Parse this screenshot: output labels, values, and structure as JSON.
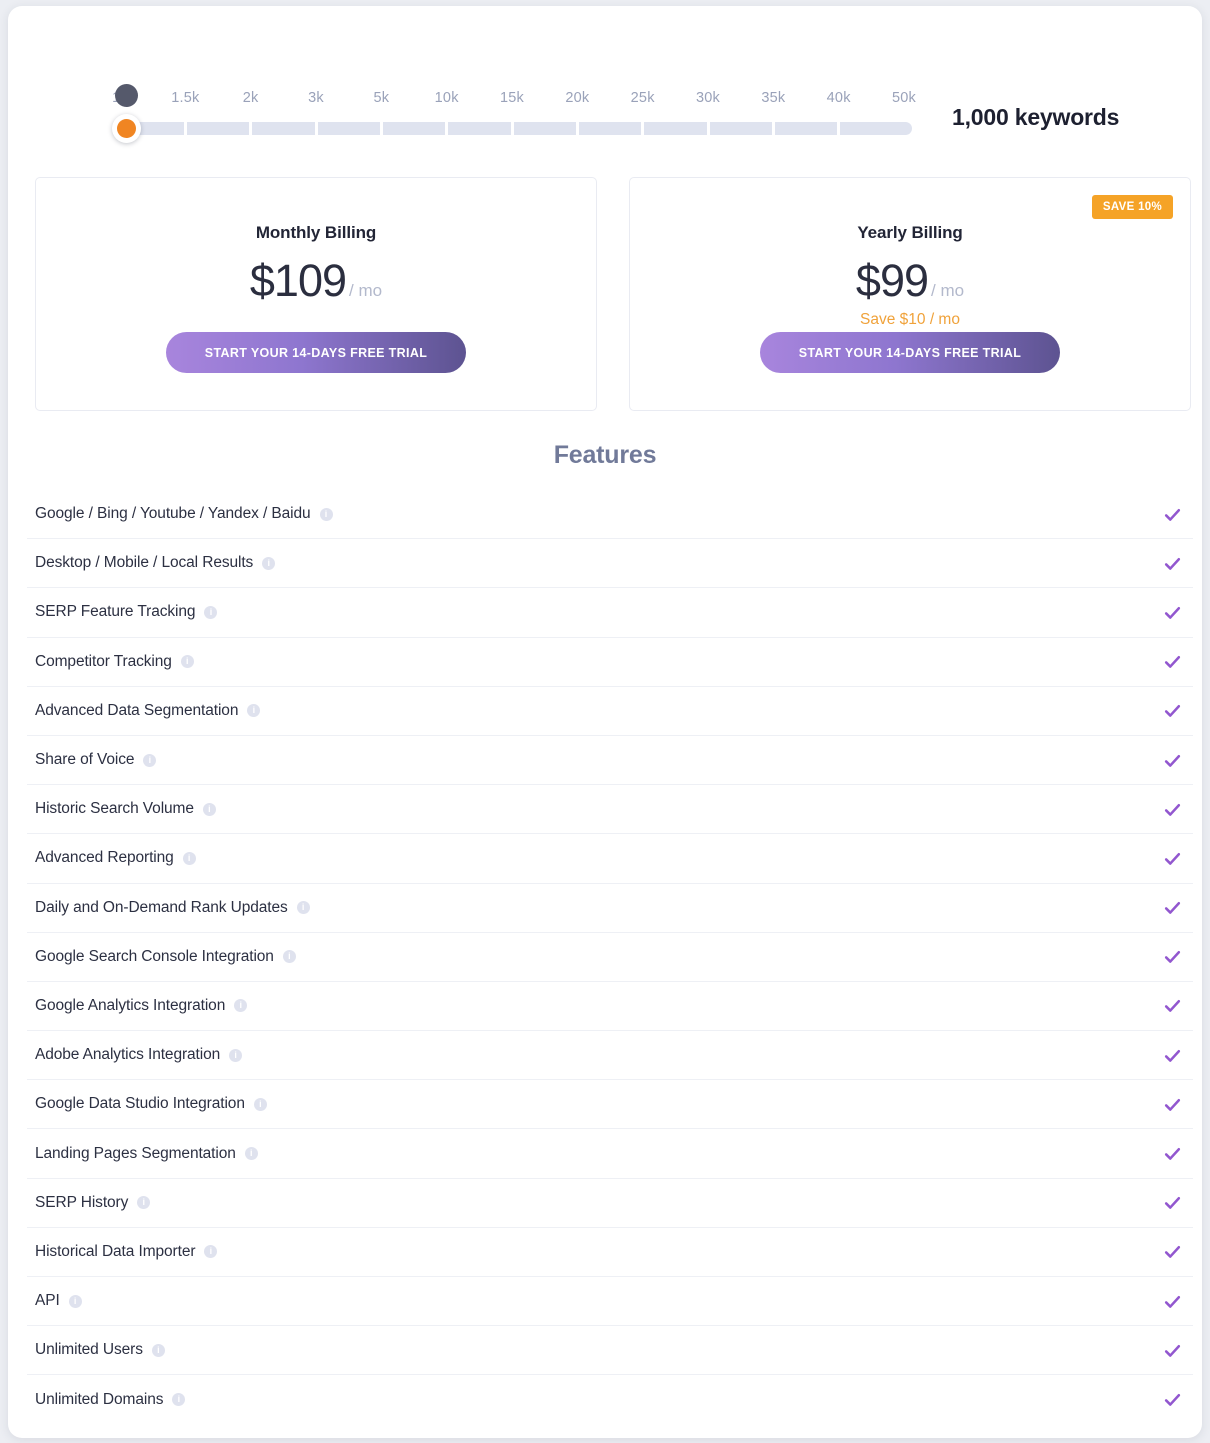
{
  "slider": {
    "tick_labels": [
      "1k",
      "1.5k",
      "2k",
      "3k",
      "5k",
      "10k",
      "15k",
      "20k",
      "25k",
      "30k",
      "35k",
      "40k",
      "50k"
    ],
    "selected_label": "1k",
    "selected_index": 0,
    "thumb_color": "#f08522",
    "tooltip_color": "#55596b",
    "track_color": "#dfe3ef",
    "keywords_total": "1,000 keywords"
  },
  "plans": [
    {
      "id": "monthly",
      "title": "Monthly Billing",
      "price": "$109",
      "period": "/ mo",
      "save_text": "",
      "badge": "",
      "cta_label": "START YOUR 14-DAYS FREE TRIAL"
    },
    {
      "id": "yearly",
      "title": "Yearly Billing",
      "price": "$99",
      "period": "/ mo",
      "save_text": "Save $10 / mo",
      "badge": "SAVE 10%",
      "cta_label": "START YOUR 14-DAYS FREE TRIAL"
    }
  ],
  "features": {
    "heading": "Features",
    "info_glyph": "i",
    "check_color": "#9257cf",
    "items": [
      {
        "label": "Google / Bing / Youtube / Yandex / Baidu",
        "included": true
      },
      {
        "label": "Desktop / Mobile / Local Results",
        "included": true
      },
      {
        "label": "SERP Feature Tracking",
        "included": true
      },
      {
        "label": "Competitor Tracking",
        "included": true
      },
      {
        "label": "Advanced Data Segmentation",
        "included": true
      },
      {
        "label": "Share of Voice",
        "included": true
      },
      {
        "label": "Historic Search Volume",
        "included": true
      },
      {
        "label": "Advanced Reporting",
        "included": true
      },
      {
        "label": "Daily and On-Demand Rank Updates",
        "included": true
      },
      {
        "label": "Google Search Console Integration",
        "included": true
      },
      {
        "label": "Google Analytics Integration",
        "included": true
      },
      {
        "label": "Adobe Analytics Integration",
        "included": true
      },
      {
        "label": "Google Data Studio Integration",
        "included": true
      },
      {
        "label": "Landing Pages Segmentation",
        "included": true
      },
      {
        "label": "SERP History",
        "included": true
      },
      {
        "label": "Historical Data Importer",
        "included": true
      },
      {
        "label": "API",
        "included": true
      },
      {
        "label": "Unlimited Users",
        "included": true
      },
      {
        "label": "Unlimited Domains",
        "included": true
      }
    ]
  },
  "colors": {
    "accent_purple": "#9257cf",
    "accent_orange": "#f5a327",
    "page_background": "#eceef3",
    "panel_background": "#ffffff"
  }
}
